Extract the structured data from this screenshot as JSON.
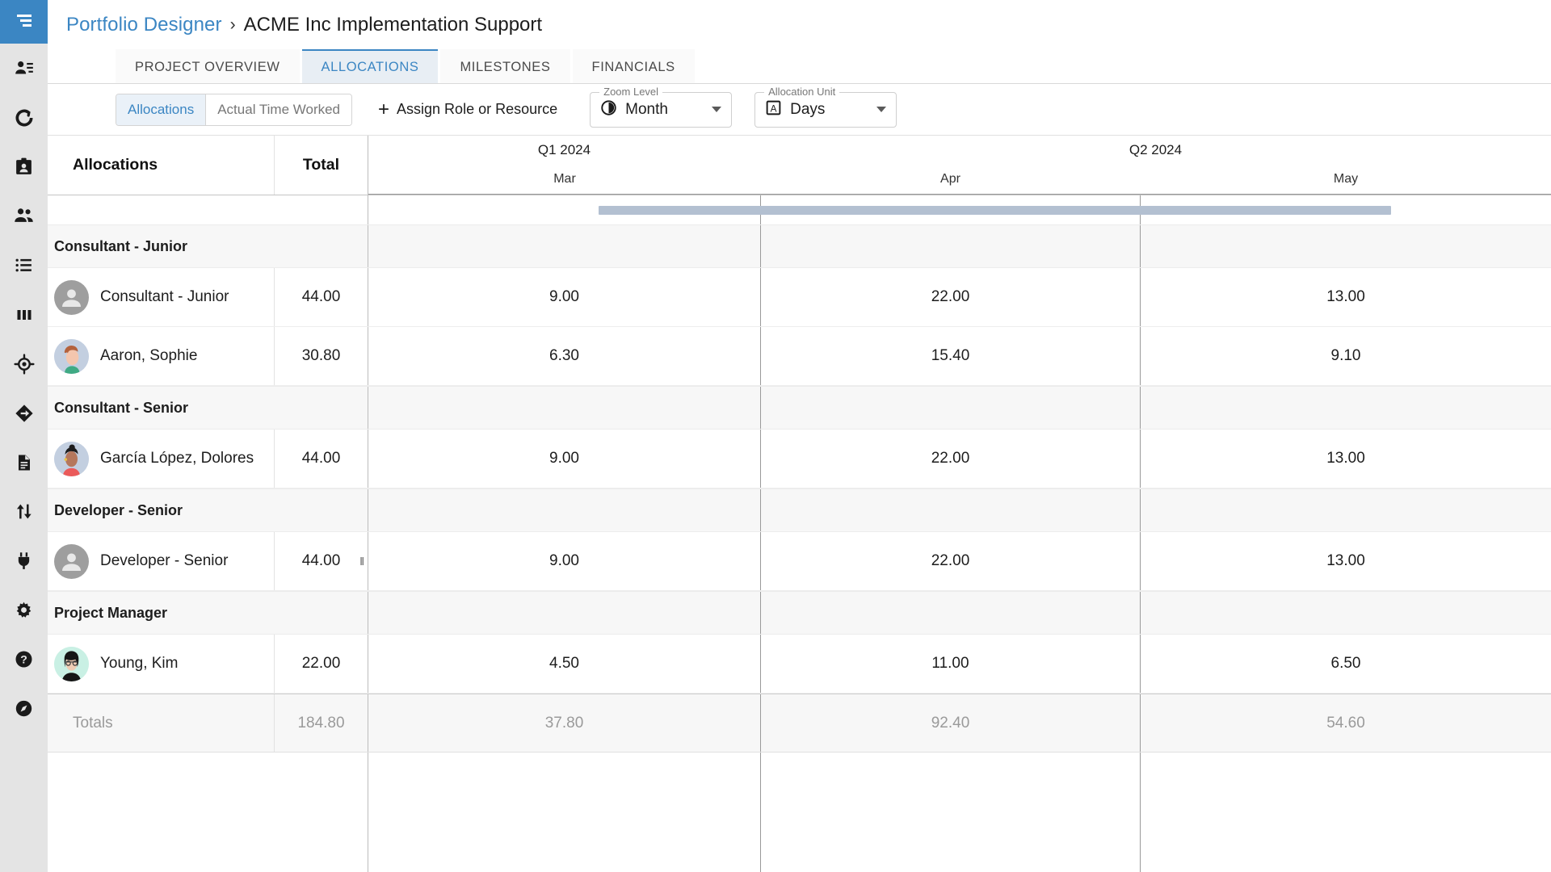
{
  "sidebar": {
    "menu_icon": "hamburger-menu-icon",
    "items": [
      {
        "icon": "person-details-icon"
      },
      {
        "icon": "refresh-circle-icon"
      },
      {
        "icon": "id-badge-icon"
      },
      {
        "icon": "people-group-icon"
      },
      {
        "icon": "list-icon"
      },
      {
        "icon": "columns-chart-icon"
      },
      {
        "icon": "target-crosshair-icon"
      },
      {
        "icon": "diamond-arrow-icon"
      },
      {
        "icon": "document-icon"
      },
      {
        "icon": "transfer-arrows-icon"
      },
      {
        "icon": "plug-icon"
      },
      {
        "icon": "gear-icon"
      },
      {
        "icon": "help-circle-icon"
      },
      {
        "icon": "compass-icon"
      }
    ]
  },
  "breadcrumb": {
    "root": "Portfolio Designer",
    "separator": "›",
    "current": "ACME Inc Implementation Support"
  },
  "tabs": [
    {
      "label": "PROJECT OVERVIEW",
      "active": false
    },
    {
      "label": "ALLOCATIONS",
      "active": true
    },
    {
      "label": "MILESTONES",
      "active": false
    },
    {
      "label": "FINANCIALS",
      "active": false
    }
  ],
  "toolbar": {
    "segmented": [
      {
        "label": "Allocations",
        "active": true
      },
      {
        "label": "Actual Time Worked",
        "active": false
      }
    ],
    "assign_button": {
      "label": "Assign Role or Resource",
      "plus": "+"
    },
    "zoom_level": {
      "legend": "Zoom Level",
      "value": "Month",
      "icon": "half-moon-clock-icon"
    },
    "allocation_unit": {
      "legend": "Allocation Unit",
      "value": "Days",
      "icon": "boxed-a-icon"
    }
  },
  "grid": {
    "headers": {
      "allocations": "Allocations",
      "total": "Total"
    },
    "quarters": [
      {
        "label": "Q1 2024",
        "months": 1
      },
      {
        "label": "Q2 2024",
        "months": 2
      }
    ],
    "months": [
      "Mar",
      "Apr",
      "May"
    ],
    "span_bar_color": "#b3c0d1",
    "groups": [
      {
        "label": "Consultant - Junior",
        "rows": [
          {
            "name": "Consultant - Junior",
            "avatar": "placeholder-person-avatar",
            "total": "44.00",
            "values": [
              "9.00",
              "22.00",
              "13.00"
            ]
          },
          {
            "name": "Aaron, Sophie",
            "avatar": "photo-avatar-sophie",
            "total": "30.80",
            "values": [
              "6.30",
              "15.40",
              "9.10"
            ]
          }
        ]
      },
      {
        "label": "Consultant - Senior",
        "rows": [
          {
            "name": "García López, Dolores",
            "avatar": "photo-avatar-dolores",
            "total": "44.00",
            "values": [
              "9.00",
              "22.00",
              "13.00"
            ]
          }
        ]
      },
      {
        "label": "Developer - Senior",
        "rows": [
          {
            "name": "Developer - Senior",
            "avatar": "placeholder-person-avatar",
            "total": "44.00",
            "values": [
              "9.00",
              "22.00",
              "13.00"
            ],
            "resize_handle": "‖"
          }
        ]
      },
      {
        "label": "Project Manager",
        "rows": [
          {
            "name": "Young, Kim",
            "avatar": "photo-avatar-kim",
            "total": "22.00",
            "values": [
              "4.50",
              "11.00",
              "6.50"
            ]
          }
        ]
      }
    ],
    "totals": {
      "label": "Totals",
      "total": "184.80",
      "values": [
        "37.80",
        "92.40",
        "54.60"
      ]
    }
  }
}
